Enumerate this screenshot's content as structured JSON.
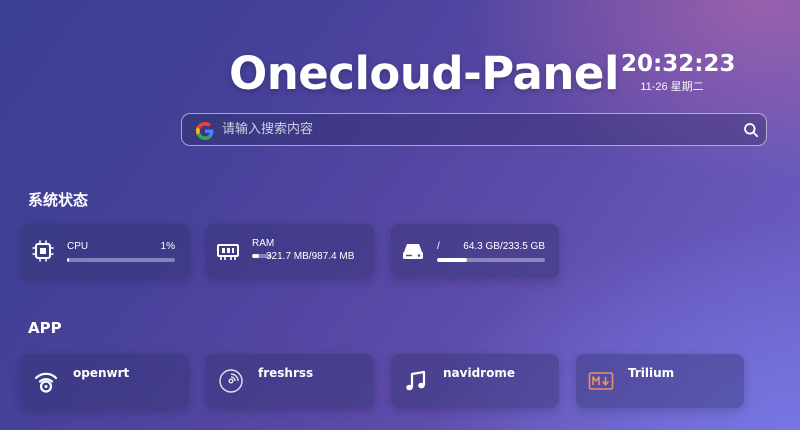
{
  "header": {
    "title": "Onecloud-Panel",
    "time": "20:32:23",
    "date": "11-26 星期二"
  },
  "search": {
    "placeholder": "请输入搜索内容",
    "engine_icon": "google-icon",
    "submit_icon": "search-icon"
  },
  "system_status": {
    "title": "系统状态",
    "items": [
      {
        "name": "CPU",
        "value": "1%",
        "usage": 0.01,
        "icon": "cpu-icon"
      },
      {
        "name": "RAM",
        "value": "321.7 MB/987.4 MB",
        "usage": 0.326,
        "icon": "ram-icon"
      },
      {
        "name": "/",
        "value": "64.3 GB/233.5 GB",
        "usage": 0.275,
        "icon": "disk-icon"
      }
    ]
  },
  "apps": {
    "title": "APP",
    "items": [
      {
        "name": "openwrt",
        "icon": "wifi-icon"
      },
      {
        "name": "freshrss",
        "icon": "disc-icon"
      },
      {
        "name": "navidrome",
        "icon": "music-note-icon"
      },
      {
        "name": "Trilium",
        "icon": "markdown-icon"
      }
    ]
  },
  "colors": {
    "background_start": "#3a3f91",
    "background_end": "#6e63c8",
    "accent": "#ffffff",
    "markdown_icon": "#e8906a"
  }
}
